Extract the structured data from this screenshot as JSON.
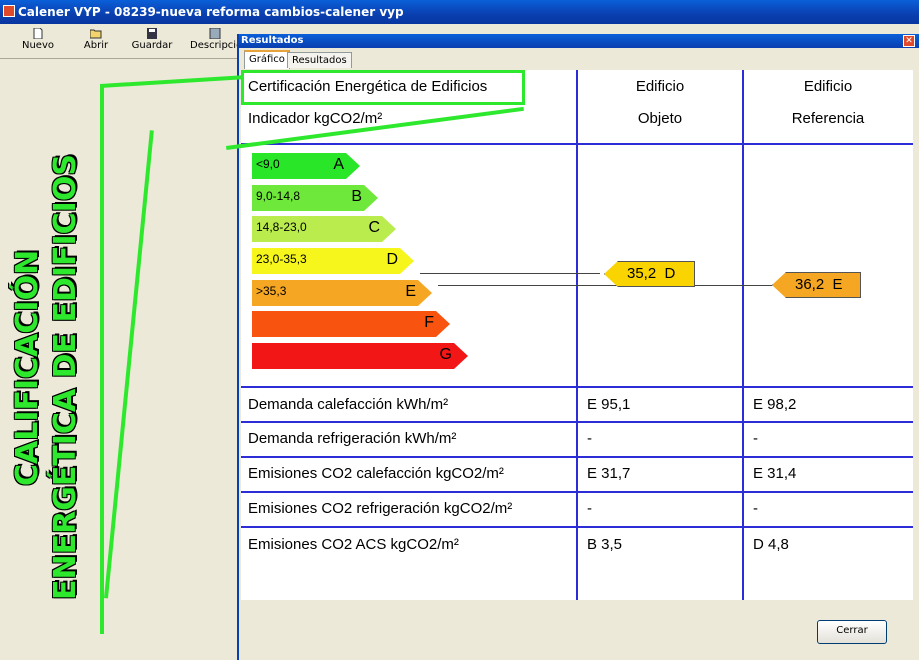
{
  "app": {
    "title": "Calener VYP - 08239-nueva reforma cambios-calener vyp"
  },
  "toolbar": {
    "nuevo": "Nuevo",
    "abrir": "Abrir",
    "guardar": "Guardar",
    "descripcion": "Descripción"
  },
  "left_annotation": {
    "line1": "CALIFICACIÓN",
    "line2": "ENERGÉTICA DE EDIFICIOS"
  },
  "results_window": {
    "title": "Resultados",
    "tabs": [
      "Gráfico",
      "Resultados"
    ],
    "close_label": "Cerrar"
  },
  "header": {
    "title": "Certificación Energética de Edificios",
    "indicator": "Indicador kgCO2/m²",
    "col_objeto_1": "Edificio",
    "col_objeto_2": "Objeto",
    "col_ref_1": "Edificio",
    "col_ref_2": "Referencia"
  },
  "scale": [
    {
      "letter": "A",
      "range": "<9,0",
      "color": "#29e629"
    },
    {
      "letter": "B",
      "range": "9,0-14,8",
      "color": "#6ee83a"
    },
    {
      "letter": "C",
      "range": "14,8-23,0",
      "color": "#b9ec4c"
    },
    {
      "letter": "D",
      "range": "23,0-35,3",
      "color": "#f6f61d"
    },
    {
      "letter": "E",
      "range": ">35,3",
      "color": "#f5a623"
    },
    {
      "letter": "F",
      "range": "",
      "color": "#f8540f"
    },
    {
      "letter": "G",
      "range": "",
      "color": "#f31616"
    }
  ],
  "indicators": {
    "objeto": {
      "value": "35,2",
      "letter": "D"
    },
    "referencia": {
      "value": "36,2",
      "letter": "E"
    }
  },
  "rows": [
    {
      "label": "Demanda calefacción kWh/m²",
      "objeto": "E 95,1",
      "referencia": "E 98,2"
    },
    {
      "label": "Demanda refrigeración kWh/m²",
      "objeto": "-",
      "referencia": "-"
    },
    {
      "label": "Emisiones CO2 calefacción kgCO2/m²",
      "objeto": "E 31,7",
      "referencia": "E 31,4"
    },
    {
      "label": "Emisiones CO2 refrigeración kgCO2/m²",
      "objeto": "-",
      "referencia": "-"
    },
    {
      "label": "Emisiones CO2 ACS kgCO2/m²",
      "objeto": "B 3,5",
      "referencia": "D 4,8"
    }
  ]
}
